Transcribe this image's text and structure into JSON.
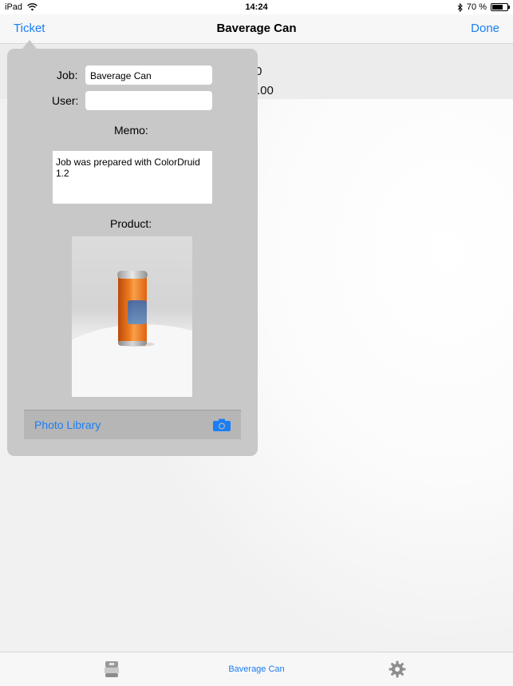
{
  "status_bar": {
    "device": "iPad",
    "time": "14:24",
    "battery_text": "70 %",
    "battery_level": 0.7,
    "icons": [
      "wifi-icon",
      "bluetooth-icon",
      "battery-icon"
    ]
  },
  "nav": {
    "back_label": "Ticket",
    "title": "Baverage Can",
    "done_label": "Done"
  },
  "background_values": {
    "row1": "0",
    "row2": ".00"
  },
  "popover": {
    "job_label": "Job:",
    "job_value": "Baverage Can",
    "user_label": "User:",
    "user_value": "",
    "memo_label": "Memo:",
    "memo_value": "Job was prepared with ColorDruid 1.2",
    "product_label": "Product:",
    "photo_library_label": "Photo Library",
    "photo_icon": "camera-icon"
  },
  "tabbar": {
    "left_icon": "device-icon",
    "center_label": "Baverage Can",
    "right_icon": "gear-icon"
  },
  "colors": {
    "accent": "#1a7ef5",
    "popover_bg": "#c8c8c8"
  }
}
